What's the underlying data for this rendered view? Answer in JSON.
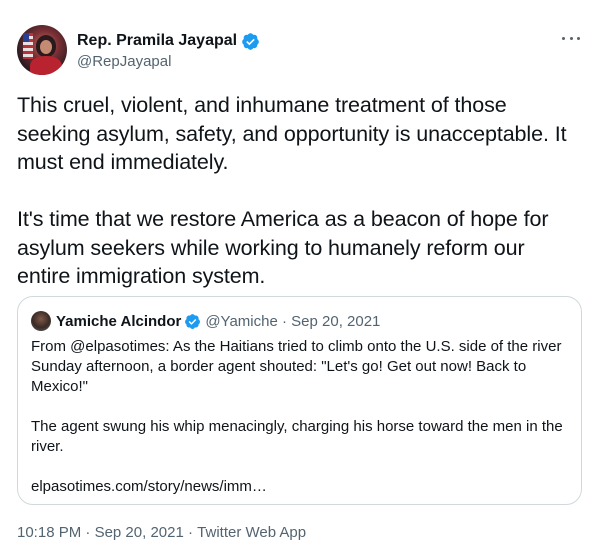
{
  "author": {
    "display_name": "Rep. Pramila Jayapal",
    "handle": "@RepJayapal",
    "verified": true,
    "avatar_icon": "profile-photo"
  },
  "more_icon": "more-dots-icon",
  "tweet": {
    "paragraphs": [
      "This cruel, violent, and inhumane treatment of those seeking asylum, safety, and opportunity is unacceptable. It must end immediately.",
      "It's time that we restore America as a beacon of hope for asylum seekers while working to humanely reform our entire immigration system."
    ]
  },
  "quote": {
    "display_name": "Yamiche Alcindor",
    "handle": "@Yamiche",
    "separator": "·",
    "date": "Sep 20, 2021",
    "verified": true,
    "paragraphs": [
      "From @elpasotimes: As the Haitians tried to climb onto the U.S. side of the river Sunday afternoon, a border agent shouted: \"Let's go! Get out now! Back to Mexico!\"",
      "The agent swung his whip menacingly, charging his horse toward the men in the river.",
      "elpasotimes.com/story/news/imm…"
    ]
  },
  "footer": {
    "time": "10:18 PM",
    "date": "Sep 20, 2021",
    "source": "Twitter Web App",
    "separator": "·"
  },
  "colors": {
    "verified_blue": "#1d9bf0",
    "text_primary": "#0f1419",
    "text_secondary": "#536471",
    "border": "#cfd9de"
  }
}
